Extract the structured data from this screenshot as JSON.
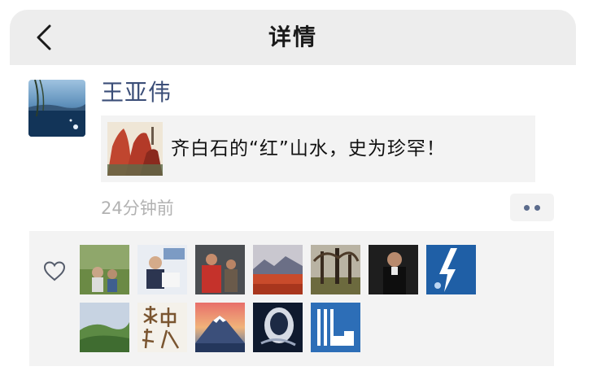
{
  "navbar": {
    "title": "详情"
  },
  "post": {
    "author": "王亚伟",
    "link_title": "齐白石的“红”山水，史为珍罕！",
    "timestamp": "24分钟前"
  },
  "likes": {
    "liker_count": 12
  },
  "colors": {
    "nav_bg": "#ededed",
    "author_name": "#3b4e78",
    "card_bg": "#f3f3f3",
    "timestamp": "#b2b2b2"
  },
  "icons": [
    "back-arrow-icon",
    "more-dots-icon",
    "heart-outline-icon"
  ]
}
